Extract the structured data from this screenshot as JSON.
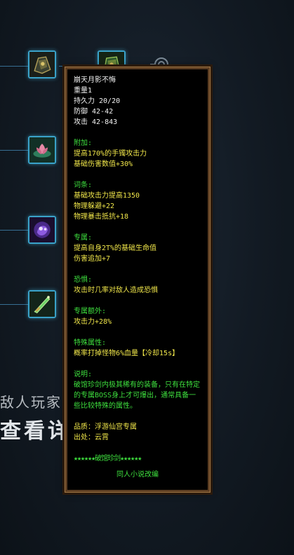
{
  "background": {
    "text_line1": "敌人玩家而",
    "text_line2": "查看详"
  },
  "skill_slots": [
    {
      "name": "dark-armor"
    },
    {
      "name": "green-armor"
    },
    {
      "name": "lotus"
    },
    {
      "name": "purple-spirit"
    },
    {
      "name": "jade-sword"
    }
  ],
  "tooltip": {
    "item_name": "崩天月影不悔",
    "weight": "重量1",
    "durability": "持久力 20/20",
    "defense": "防御 42-42",
    "attack": "攻击 42-843",
    "bonus_header": "附加:",
    "bonus": [
      "提高170%的手镯攻击力",
      "基础伤害数值+30%"
    ],
    "affix_header": "词条:",
    "affixes": [
      "基础攻击力提高1350",
      "物理躲避+22",
      "物理暴击抵抗+18"
    ],
    "exclusive_header": "专属:",
    "exclusive": [
      "提高自身2T%的基础生命值",
      "伤害追加+7"
    ],
    "fear_header": "恐惧:",
    "fear": [
      "攻击时几率对敌人造成恐惧"
    ],
    "extra_header": "专属额外:",
    "extra": [
      "攻击力+28%"
    ],
    "special_header": "特殊属性:",
    "special": [
      "概率打掉怪物6%血量【冷却15s】"
    ],
    "desc_header": "说明:",
    "description": "破馆珍剑内极其稀有的装备，只有在特定的专属BOSS身上才可爆出，通常具备一些比较特殊的属性。",
    "quality": "品质：浮游仙宫专属",
    "origin": "出处：云霄",
    "stars_title": "★★★★★★破馆珍剑★★★★★★",
    "footer": "同人小说改编"
  },
  "colors": {
    "tooltip_border": "#5d3e22",
    "text_white": "#f2f2f2",
    "text_yellow": "#f0e64a",
    "text_green": "#3ee03e",
    "slot_border": "#3aa2c9"
  }
}
